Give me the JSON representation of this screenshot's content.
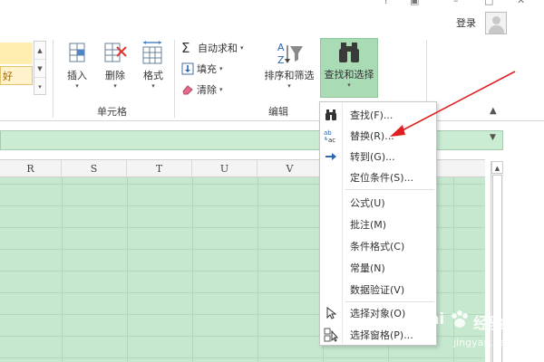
{
  "window": {
    "login_label": "登录"
  },
  "ribbon": {
    "style_cell_text": "好",
    "cells_group": {
      "label": "单元格",
      "insert": "插入",
      "delete": "删除",
      "format": "格式"
    },
    "editing_group": {
      "label": "编辑",
      "autosum": "自动求和",
      "fill": "填充",
      "clear": "清除",
      "sort_filter": "排序和筛选",
      "find_select": "查找和选择"
    }
  },
  "grid": {
    "columns": [
      "R",
      "S",
      "T",
      "U",
      "V"
    ]
  },
  "menu": {
    "items": [
      {
        "label": "查找(F)...",
        "icon": "binoculars-icon"
      },
      {
        "label": "替换(R)...",
        "icon": "replace-icon"
      },
      {
        "label": "转到(G)...",
        "icon": "arrow-right-icon"
      },
      {
        "label": "定位条件(S)...",
        "icon": ""
      },
      {
        "label": "公式(U)",
        "icon": ""
      },
      {
        "label": "批注(M)",
        "icon": ""
      },
      {
        "label": "条件格式(C)",
        "icon": ""
      },
      {
        "label": "常量(N)",
        "icon": ""
      },
      {
        "label": "数据验证(V)",
        "icon": ""
      },
      {
        "label": "选择对象(O)",
        "icon": "select-objects-icon"
      },
      {
        "label": "选择窗格(P)...",
        "icon": "selection-pane-icon"
      }
    ]
  },
  "watermark": {
    "brand": "Bai",
    "brand2": "经验",
    "sub": "jingyan.baidu.com"
  },
  "colors": {
    "accent_green": "#a9dcb5",
    "sheet_green": "#c6e8cf",
    "arrow_red": "#e02020"
  }
}
